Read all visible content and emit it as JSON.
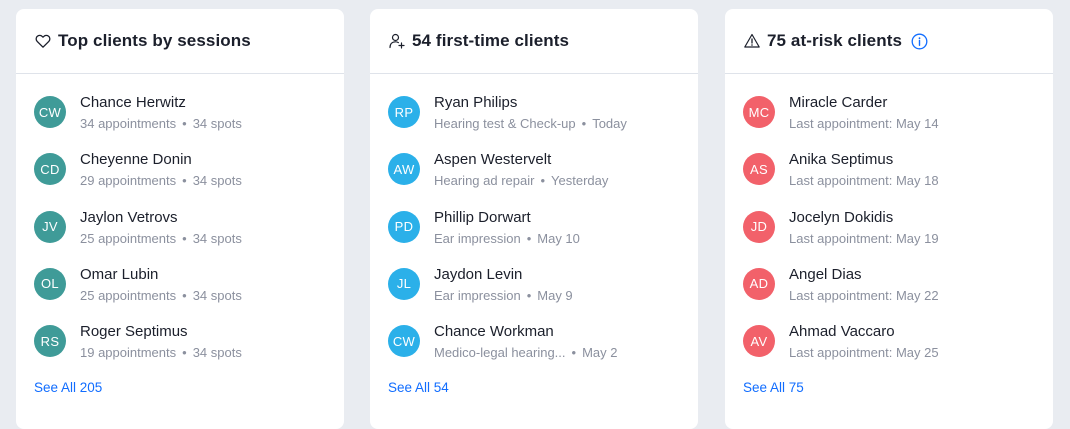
{
  "colors": {
    "teal": "#3f9b98",
    "sky": "#2bb0e9",
    "coral": "#f2616a",
    "link": "#116dff"
  },
  "cards": [
    {
      "icon": "heart-icon",
      "title": "Top clients by sessions",
      "see_all": "See All 205",
      "clients": [
        {
          "initials": "CW",
          "name": "Chance Herwitz",
          "detail": "34 appointments",
          "extra": "34 spots"
        },
        {
          "initials": "CD",
          "name": "Cheyenne Donin",
          "detail": "29 appointments",
          "extra": "34 spots"
        },
        {
          "initials": "JV",
          "name": "Jaylon Vetrovs",
          "detail": "25 appointments",
          "extra": "34 spots"
        },
        {
          "initials": "OL",
          "name": "Omar Lubin",
          "detail": "25 appointments",
          "extra": "34 spots"
        },
        {
          "initials": "RS",
          "name": "Roger Septimus",
          "detail": "19 appointments",
          "extra": "34 spots"
        }
      ]
    },
    {
      "icon": "user-plus-icon",
      "title": "54 first-time clients",
      "see_all": "See All 54",
      "clients": [
        {
          "initials": "RP",
          "name": "Ryan Philips",
          "detail": "Hearing test & Check-up",
          "extra": "Today"
        },
        {
          "initials": "AW",
          "name": "Aspen Westervelt",
          "detail": "Hearing ad repair",
          "extra": "Yesterday"
        },
        {
          "initials": "PD",
          "name": "Phillip Dorwart",
          "detail": "Ear impression",
          "extra": "May 10"
        },
        {
          "initials": "JL",
          "name": "Jaydon Levin",
          "detail": "Ear impression",
          "extra": "May 9"
        },
        {
          "initials": "CW",
          "name": "Chance Workman",
          "detail": "Medico-legal hearing...",
          "extra": "May 2"
        }
      ]
    },
    {
      "icon": "warning-icon",
      "title": "75 at-risk clients",
      "see_all": "See All 75",
      "clients": [
        {
          "initials": "MC",
          "name": "Miracle Carder",
          "detail": "Last appointment: May 14"
        },
        {
          "initials": "AS",
          "name": "Anika Septimus",
          "detail": "Last appointment: May 18"
        },
        {
          "initials": "JD",
          "name": "Jocelyn Dokidis",
          "detail": "Last appointment: May 19"
        },
        {
          "initials": "AD",
          "name": "Angel Dias",
          "detail": "Last appointment: May 22"
        },
        {
          "initials": "AV",
          "name": "Ahmad Vaccaro",
          "detail": "Last appointment: May 25"
        }
      ]
    }
  ]
}
